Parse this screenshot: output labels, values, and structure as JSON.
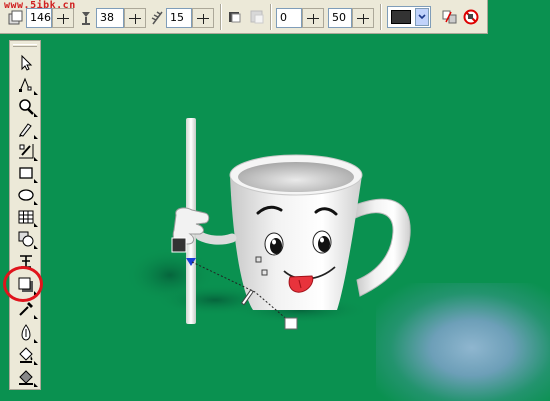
{
  "watermark": "www.5ibk.cn",
  "propbar": {
    "spin1_value": "146",
    "spin2_value": "38",
    "spin3_value": "15",
    "spin4_value": "0",
    "spin5_value": "50",
    "color_value": "#333333"
  },
  "toolbox": {
    "tools": [
      "pick-tool-icon",
      "shape-tool-icon",
      "zoom-tool-icon",
      "freehand-tool-icon",
      "smart-fill-icon",
      "rectangle-tool-icon",
      "ellipse-tool-icon",
      "graph-paper-icon",
      "basic-shapes-icon",
      "text-tool-icon",
      "interactive-shadow-tool-icon",
      "eyedropper-tool-icon",
      "outline-tool-icon",
      "fill-tool-icon",
      "interactive-fill-icon"
    ],
    "active_tool": "interactive-shadow-tool-icon"
  },
  "colors": {
    "background": "#0a9150",
    "highlight": "#e0141c",
    "toolbar": "#ece9d8"
  }
}
